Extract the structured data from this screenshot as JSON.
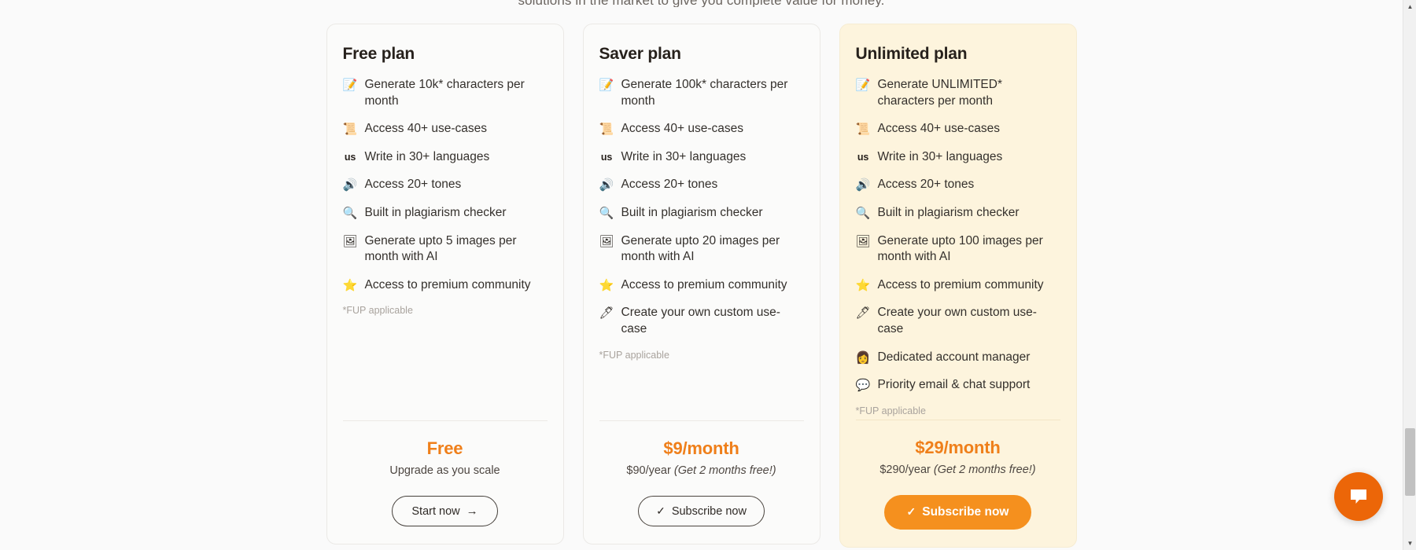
{
  "intro_text": "solutions in the market to give you complete value for money.",
  "colors": {
    "accent": "#ef7f1a",
    "cta_solid": "#f5901e",
    "featured_card_bg": "#fdf4dd",
    "plain_card_bg": "#fbfbfa",
    "chat_bubble": "#ec6608"
  },
  "plans": [
    {
      "title": "Free plan",
      "featured": false,
      "features": [
        {
          "icon": "memo-icon",
          "glyph": "📝",
          "text": "Generate 10k* characters per month"
        },
        {
          "icon": "scroll-icon",
          "glyph": "📜",
          "text": "Access 40+ use-cases"
        },
        {
          "icon": "language-abbr-icon",
          "glyph": "us",
          "text": "Write in 30+ languages"
        },
        {
          "icon": "speaker-icon",
          "glyph": "🔊",
          "text": "Access 20+ tones"
        },
        {
          "icon": "magnifier-icon",
          "glyph": "🔍",
          "text": "Built in plagiarism checker"
        },
        {
          "icon": "framed-picture-icon",
          "glyph": "🖼",
          "text": "Generate upto 5 images per month with AI"
        },
        {
          "icon": "star-icon",
          "glyph": "⭐",
          "text": "Access to premium community"
        }
      ],
      "footnote": "*FUP applicable",
      "price_main": "Free",
      "price_sub_plain": "Upgrade as you scale",
      "price_sub_promo": "",
      "cta_label": "Start now",
      "cta_icon": "arrow-right-icon",
      "cta_glyph": "→",
      "cta_style": "outline"
    },
    {
      "title": "Saver plan",
      "featured": false,
      "features": [
        {
          "icon": "memo-icon",
          "glyph": "📝",
          "text": "Generate 100k* characters per month"
        },
        {
          "icon": "scroll-icon",
          "glyph": "📜",
          "text": "Access 40+ use-cases"
        },
        {
          "icon": "language-abbr-icon",
          "glyph": "us",
          "text": "Write in 30+ languages"
        },
        {
          "icon": "speaker-icon",
          "glyph": "🔊",
          "text": "Access 20+ tones"
        },
        {
          "icon": "magnifier-icon",
          "glyph": "🔍",
          "text": "Built in plagiarism checker"
        },
        {
          "icon": "framed-picture-icon",
          "glyph": "🖼",
          "text": "Generate upto 20 images per month with AI"
        },
        {
          "icon": "star-icon",
          "glyph": "⭐",
          "text": "Access to premium community"
        },
        {
          "icon": "pen-icon",
          "glyph": "🖊",
          "text": "Create your own custom use-case"
        }
      ],
      "footnote": "*FUP applicable",
      "price_main": "$9/month",
      "price_sub_plain": "$90/year ",
      "price_sub_promo": "(Get 2 months free!)",
      "cta_label": "Subscribe now",
      "cta_icon": "check-icon",
      "cta_glyph": "✓",
      "cta_style": "outline-dark"
    },
    {
      "title": "Unlimited plan",
      "featured": true,
      "features": [
        {
          "icon": "memo-icon",
          "glyph": "📝",
          "text": "Generate UNLIMITED* characters per month"
        },
        {
          "icon": "scroll-icon",
          "glyph": "📜",
          "text": "Access 40+ use-cases"
        },
        {
          "icon": "language-abbr-icon",
          "glyph": "us",
          "text": "Write in 30+ languages"
        },
        {
          "icon": "speaker-icon",
          "glyph": "🔊",
          "text": "Access 20+ tones"
        },
        {
          "icon": "magnifier-icon",
          "glyph": "🔍",
          "text": "Built in plagiarism checker"
        },
        {
          "icon": "framed-picture-icon",
          "glyph": "🖼",
          "text": "Generate upto 100 images per month with AI"
        },
        {
          "icon": "star-icon",
          "glyph": "⭐",
          "text": "Access to premium community"
        },
        {
          "icon": "pen-icon",
          "glyph": "🖊",
          "text": "Create your own custom use-case"
        },
        {
          "icon": "person-icon",
          "glyph": "👩",
          "text": "Dedicated account manager"
        },
        {
          "icon": "chat-bubble-icon",
          "glyph": "💬",
          "text": "Priority email & chat support"
        }
      ],
      "footnote": "*FUP applicable",
      "price_main": "$29/month",
      "price_sub_plain": "$290/year ",
      "price_sub_promo": "(Get 2 months free!)",
      "cta_label": "Subscribe now",
      "cta_icon": "check-icon",
      "cta_glyph": "✓",
      "cta_style": "solid"
    }
  ],
  "chat_widget": {
    "icon": "chat-bubble-icon"
  },
  "scrollbar": {
    "up_glyph": "▲",
    "down_glyph": "▼"
  }
}
